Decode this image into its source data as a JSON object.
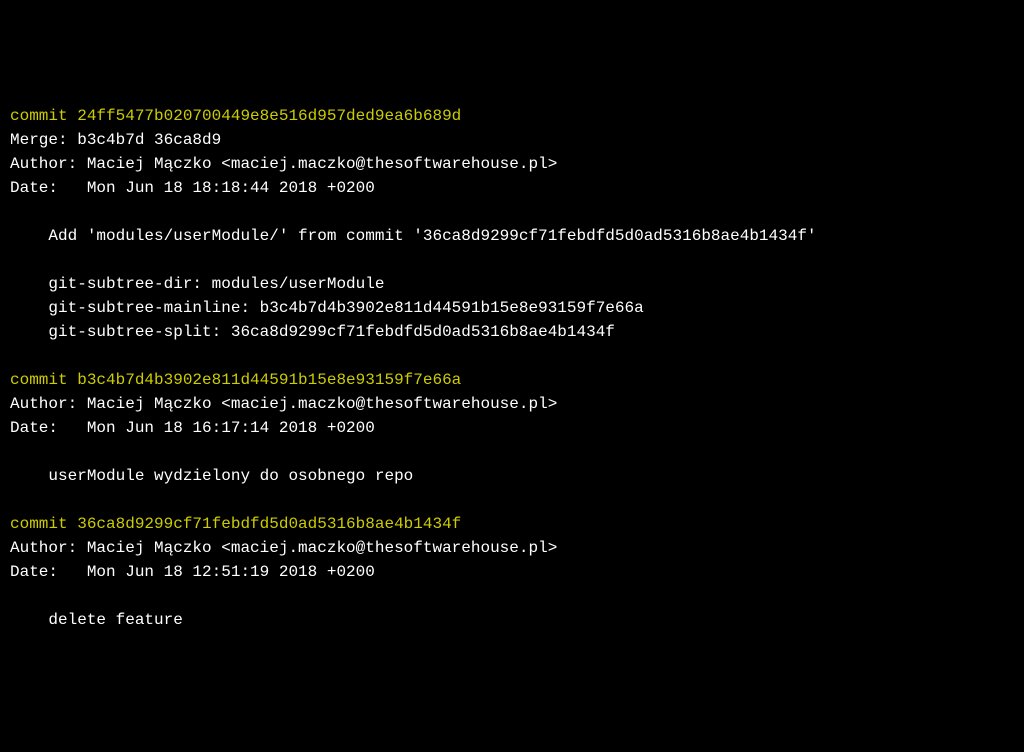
{
  "commits": [
    {
      "header": "commit 24ff5477b020700449e8e516d957ded9ea6b689d",
      "merge": "Merge: b3c4b7d 36ca8d9",
      "author": "Author: Maciej Mączko <maciej.maczko@thesoftwarehouse.pl>",
      "date": "Date:   Mon Jun 18 18:18:44 2018 +0200",
      "body": [
        "    Add 'modules/userModule/' from commit '36ca8d9299cf71febdfd5d0ad5316b8ae4b1434f'",
        "",
        "    git-subtree-dir: modules/userModule",
        "    git-subtree-mainline: b3c4b7d4b3902e811d44591b15e8e93159f7e66a",
        "    git-subtree-split: 36ca8d9299cf71febdfd5d0ad5316b8ae4b1434f"
      ]
    },
    {
      "header": "commit b3c4b7d4b3902e811d44591b15e8e93159f7e66a",
      "author": "Author: Maciej Mączko <maciej.maczko@thesoftwarehouse.pl>",
      "date": "Date:   Mon Jun 18 16:17:14 2018 +0200",
      "body": [
        "    userModule wydzielony do osobnego repo"
      ]
    },
    {
      "header": "commit 36ca8d9299cf71febdfd5d0ad5316b8ae4b1434f",
      "author": "Author: Maciej Mączko <maciej.maczko@thesoftwarehouse.pl>",
      "date": "Date:   Mon Jun 18 12:51:19 2018 +0200",
      "body": [
        "    delete feature"
      ]
    }
  ]
}
